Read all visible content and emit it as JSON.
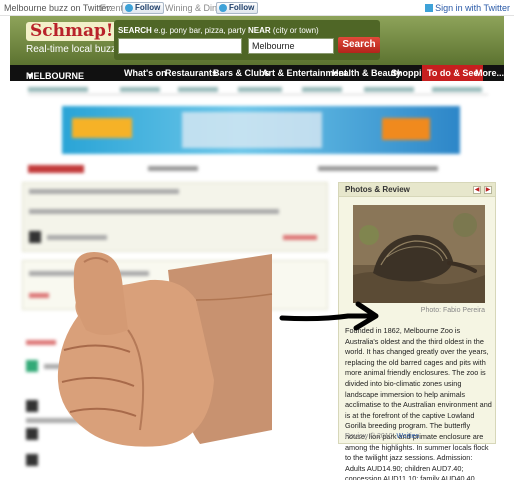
{
  "topbar": {
    "buzz_text": "Melbourne buzz on Twitter:",
    "events_label": "Events",
    "follow_label": "Follow",
    "wining_label": "Wining & Dining",
    "signin_label": "Sign in with Twitter"
  },
  "header": {
    "logo": "Schmap!!",
    "tagline": "Real-time local buzz",
    "search_label": "SEARCH",
    "search_hint": "e.g. pony bar, pizza, party",
    "near_label": "NEAR",
    "near_hint": "(city or town)",
    "search_value": "",
    "near_value": "Melbourne",
    "search_button": "Search"
  },
  "nav": {
    "city": "MELBOURNE",
    "items": [
      "What's on",
      "Restaurants",
      "Bars & Clubs",
      "Art & Entertainment",
      "Health & Beauty",
      "Shopping",
      "To do & See",
      "More..."
    ],
    "active_index": 6
  },
  "panel": {
    "title": "Photos & Review",
    "prev_icon": "arrow-left-icon",
    "next_icon": "arrow-right-icon",
    "photo_credit": "Photo: Fabio Pereira",
    "description": "Founded in 1862, Melbourne Zoo is Australia's oldest and the third oldest in the world. It has changed greatly over the years, replacing the old barred cages and pits with more animal friendly enclosures. The zoo is divided into bio-climatic zones using landscape immersion to help animals acclimatise to the Australian environment and is at the forefront of the captive Lowland Gorilla breeding program. The butterfly house, lion park and primate enclosure are among the highlights. In summer locals flock to the twilight jazz sessions. Admission: Adults AUD14.90; children AUD7.40; concession AUD11.10; family AUD40.40.",
    "review_prefix": "Review © 2010,",
    "review_source": "Wcities"
  },
  "colors": {
    "header_green": "#6e8440",
    "nav_active": "#c61f1f",
    "search_button": "#c4291f"
  }
}
